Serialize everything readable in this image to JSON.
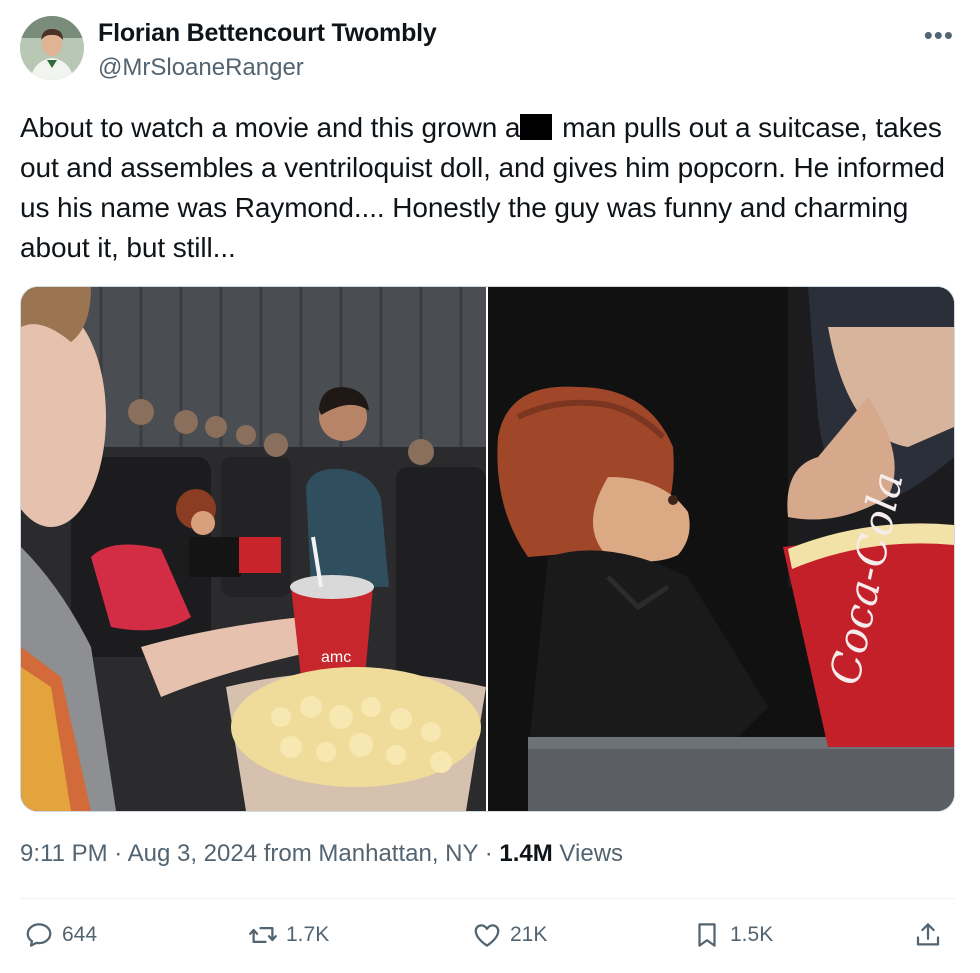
{
  "author": {
    "display_name": "Florian Bettencourt Twombly",
    "handle": "@MrSloaneRanger"
  },
  "tweet": {
    "text_part1": "About to watch a movie and this grown a",
    "text_part2": " man pulls out a suitcase, takes out and assembles a ventriloquist doll, and gives him popcorn. He informed us his name was Raymond.... Honestly the guy was funny and charming about it, but still...",
    "images": [
      {
        "cup_brand": "amc"
      },
      {
        "bucket_brand": "Coca-Cola"
      }
    ]
  },
  "meta": {
    "time": "9:11 PM",
    "sep1": " · ",
    "date": "Aug 3, 2024",
    "location_prefix": " from ",
    "location": "Manhattan, NY",
    "sep2": " · ",
    "views_count": "1.4M",
    "views_label": " Views"
  },
  "actions": {
    "replies": "644",
    "reposts": "1.7K",
    "likes": "21K",
    "bookmarks": "1.5K"
  },
  "icons": {
    "more": "more-icon",
    "reply": "reply-icon",
    "repost": "repost-icon",
    "like": "heart-icon",
    "bookmark": "bookmark-icon",
    "share": "share-icon"
  },
  "colors": {
    "text": "#0f1419",
    "secondary": "#536471",
    "border": "#cfd9de"
  }
}
